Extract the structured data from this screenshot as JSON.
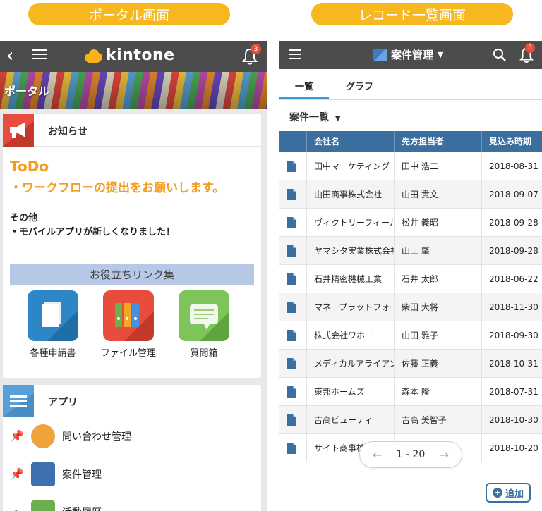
{
  "captions": {
    "left": "ポータル画面",
    "right": "レコード一覧画面"
  },
  "portal": {
    "logo": "kintone",
    "notifications": "3",
    "banner_title": "ポータル",
    "notice": {
      "title": "お知らせ",
      "todo_title": "ToDo",
      "todo_line": "・ワークフローの提出をお願いします。",
      "other_title": "その他",
      "other_line": "・モバイルアプリが新しくなりました！",
      "links_title": "お役立ちリンク集",
      "links": [
        {
          "label": "各種申請書"
        },
        {
          "label": "ファイル管理"
        },
        {
          "label": "質問箱"
        }
      ]
    },
    "apps": {
      "title": "アプリ",
      "items": [
        {
          "label": "問い合わせ管理"
        },
        {
          "label": "案件管理"
        },
        {
          "label": "活動履歴"
        }
      ]
    }
  },
  "records": {
    "app_title": "案件管理",
    "notifications": "8",
    "tabs": [
      {
        "label": "一覧"
      },
      {
        "label": "グラフ"
      }
    ],
    "view": "案件一覧",
    "columns": [
      "会社名",
      "先方担当者",
      "見込み時期"
    ],
    "rows": [
      {
        "company": "田中マーケティング",
        "contact": "田中 浩二",
        "date": "2018-08-31"
      },
      {
        "company": "山田商事株式会社",
        "contact": "山田 貴文",
        "date": "2018-09-07"
      },
      {
        "company": "ヴィクトリーフィール",
        "contact": "松井 義昭",
        "date": "2018-09-28"
      },
      {
        "company": "ヤマシタ実業株式会社",
        "contact": "山上 肇",
        "date": "2018-09-28"
      },
      {
        "company": "石井精密機械工業",
        "contact": "石井 太郎",
        "date": "2018-06-22"
      },
      {
        "company": "マネープラットフォー",
        "contact": "柴田 大将",
        "date": "2018-11-30"
      },
      {
        "company": "株式会社ワホー",
        "contact": "山田 雅子",
        "date": "2018-09-30"
      },
      {
        "company": "メディカルアライアン",
        "contact": "佐藤 正義",
        "date": "2018-10-31"
      },
      {
        "company": "東邦ホームズ",
        "contact": "森本 隆",
        "date": "2018-07-31"
      },
      {
        "company": "吉高ビューティ",
        "contact": "吉高 美智子",
        "date": "2018-10-30"
      },
      {
        "company": "サイト商事株式会社",
        "contact": "",
        "date": "2018-10-20"
      }
    ],
    "pager": "1 - 20",
    "add_label": "追加"
  }
}
